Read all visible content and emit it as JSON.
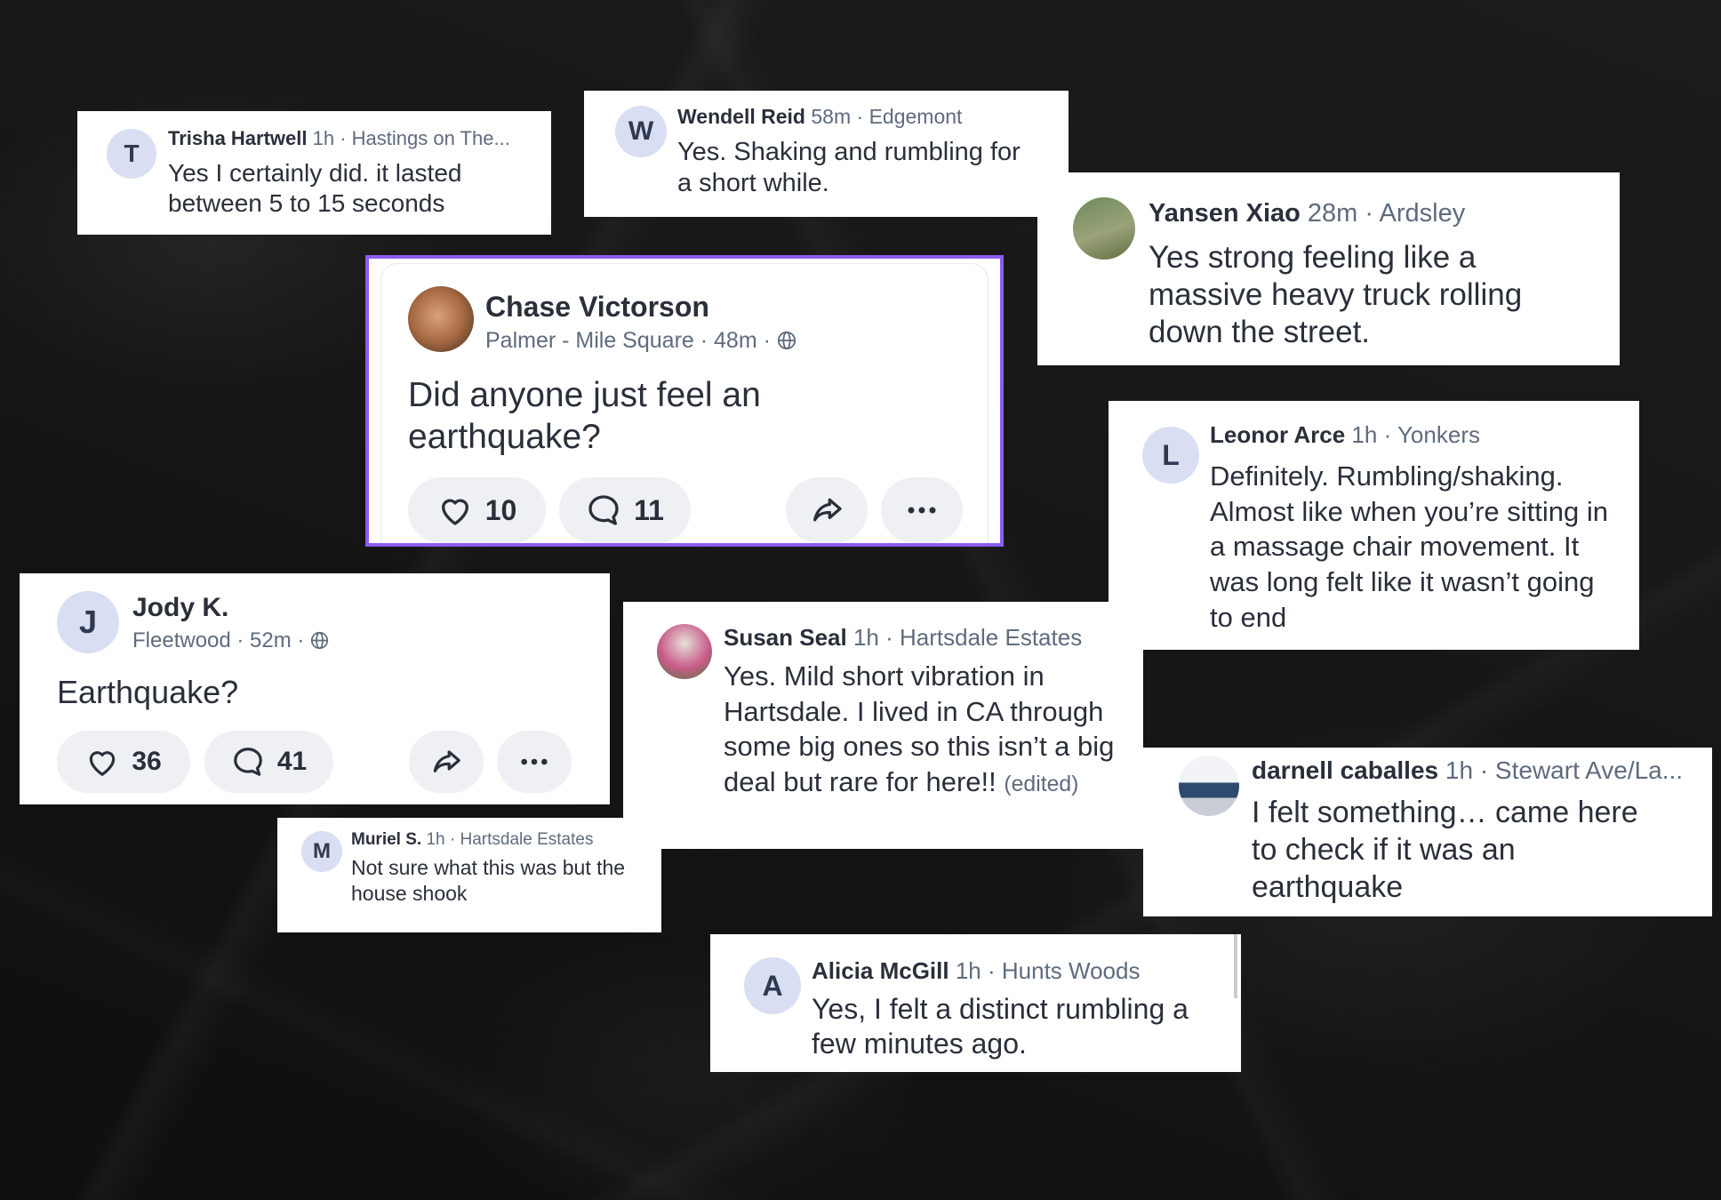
{
  "main_post": {
    "author": "Chase Victorson",
    "meta": "Palmer - Mile Square · 48m ·",
    "text": "Did anyone just feel an earthquake?",
    "likes": "10",
    "comments": "11"
  },
  "second_post": {
    "avatar_letter": "J",
    "author": "Jody K.",
    "meta": "Fleetwood · 52m ·",
    "text": "Earthquake?",
    "likes": "36",
    "comments": "41"
  },
  "replies": [
    {
      "avatar_letter": "T",
      "name": "Trisha Hartwell",
      "meta": "1h · Hastings on The...",
      "text": "Yes I certainly did.  it lasted between 5 to 15 seconds"
    },
    {
      "avatar_letter": "W",
      "name": "Wendell Reid",
      "meta": "58m · Edgemont",
      "text": "Yes.  Shaking and rumbling for a short while."
    },
    {
      "avatar_letter": "",
      "name": "Yansen Xiao",
      "meta": "28m · Ardsley",
      "text": "Yes strong feeling like a massive heavy truck rolling down the street."
    },
    {
      "avatar_letter": "L",
      "name": "Leonor Arce",
      "meta": "1h · Yonkers",
      "text": "Definitely. Rumbling/shaking. Almost like when you’re sitting in a massage chair movement. It was long felt like it wasn’t going to end"
    },
    {
      "avatar_letter": "",
      "name": "Susan Seal",
      "meta": "1h · Hartsdale Estates",
      "text": "Yes. Mild short vibration in Hartsdale. I lived in CA through some big ones so this isn’t a big deal but rare for here!!",
      "edited": "(edited)"
    },
    {
      "avatar_letter": "",
      "name": "darnell caballes",
      "meta": "1h · Stewart Ave/La...",
      "text": "I felt something… came here to check if it was an earthquake"
    },
    {
      "avatar_letter": "M",
      "name": "Muriel S.",
      "meta": "1h · Hartsdale Estates",
      "text": "Not sure what this was but the house shook"
    },
    {
      "avatar_letter": "A",
      "name": "Alicia McGill",
      "meta": "1h · Hunts Woods",
      "text": "Yes, I felt a distinct rumbling a few minutes ago."
    }
  ],
  "colors": {
    "accent_border": "#8b5cf6",
    "avatar_bg": "#d9def2",
    "pill_bg": "#eef0f4",
    "text": "#2a2f3a",
    "meta": "#5f6b7d"
  },
  "icons": [
    "heart-icon",
    "comment-icon",
    "share-icon",
    "more-icon",
    "globe-icon"
  ]
}
